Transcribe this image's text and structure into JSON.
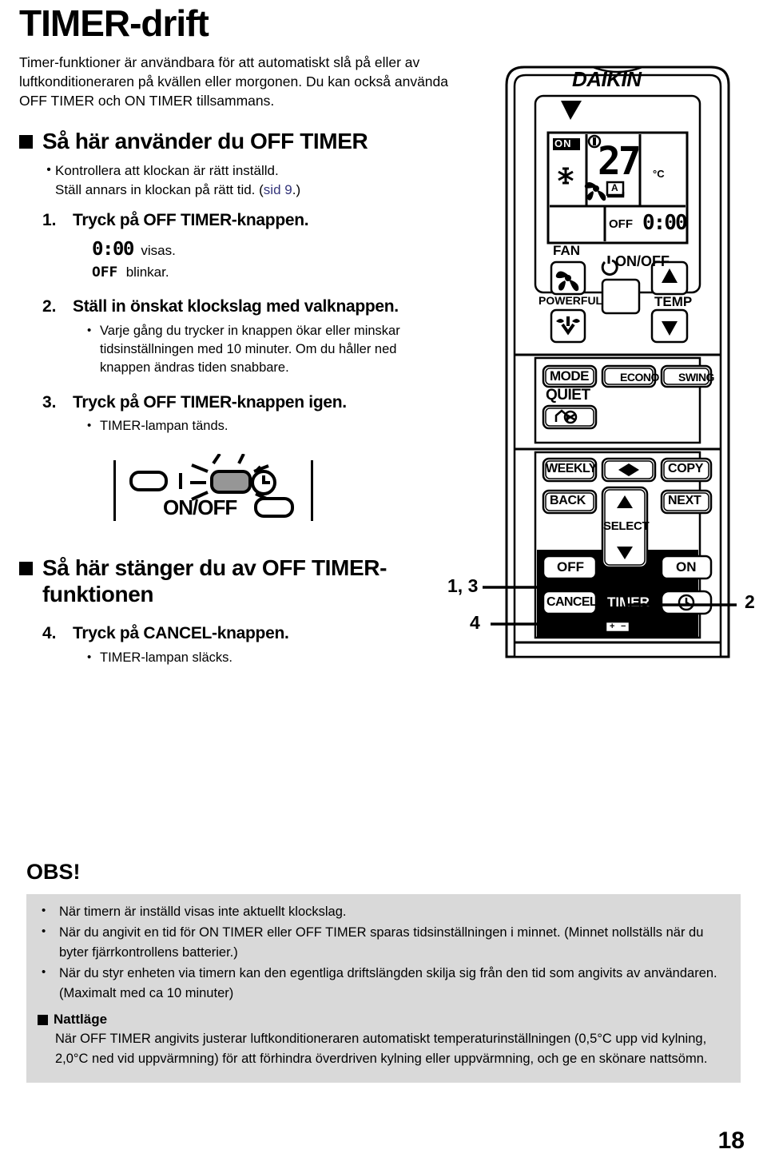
{
  "page": {
    "title": "TIMER-drift",
    "intro": "Timer-funktioner är användbara för att automatiskt slå på eller av luftkonditioneraren på kvällen eller morgonen. Du kan också använda OFF TIMER och ON TIMER tillsammans.",
    "page_number": "18"
  },
  "section_on": {
    "heading": "Så här använder du OFF TIMER",
    "note_bullet": "•",
    "note_line1": "Kontrollera att klockan är rätt inställd.",
    "note_line2_pre": "Ställ annars in klockan på rätt tid. (",
    "note_line2_link": "sid 9",
    "note_line2_post": ".)",
    "steps": [
      {
        "num": "1.",
        "title": "Tryck på OFF TIMER-knappen.",
        "lcd_time": "0:00",
        "lcd_time_label": "visas.",
        "lcd_off": "OFF",
        "lcd_off_label": "blinkar.",
        "bullets": []
      },
      {
        "num": "2.",
        "title": "Ställ in önskat klockslag med valknappen.",
        "bullets": [
          "Varje gång du trycker in knappen ökar eller minskar tidsinställningen med 10 minuter. Om du håller ned knappen ändras tiden snabbare."
        ]
      },
      {
        "num": "3.",
        "title": "Tryck på OFF TIMER-knappen igen.",
        "bullets": [
          "TIMER-lampan tänds."
        ]
      }
    ],
    "lamp_label": "ON/OFF"
  },
  "section_off": {
    "heading": "Så här stänger du av OFF TIMER-funktionen",
    "steps": [
      {
        "num": "4.",
        "title": "Tryck på CANCEL-knappen.",
        "bullets": [
          "TIMER-lampan släcks."
        ]
      }
    ]
  },
  "obs": {
    "heading": "OBS!",
    "bullet": "•",
    "items": [
      "När timern är inställd visas inte aktuellt klockslag.",
      "När du angivit en tid för ON TIMER eller OFF TIMER sparas tidsinställningen i minnet. (Minnet nollställs när du byter fjärrkontrollens batterier.)",
      "När du styr enheten via timern kan den egentliga driftslängden skilja sig från den tid som angivits av användaren. (Maximalt med ca 10 minuter)"
    ],
    "night": {
      "title": "Nattläge",
      "body": "När OFF TIMER angivits justerar luftkonditioneraren automatiskt temperaturinställningen (0,5°C upp vid kylning, 2,0°C ned vid uppvärmning) för att förhindra överdriven kylning eller uppvärmning, och ge en skönare nattsömn."
    }
  },
  "remote": {
    "brand": "DAIKIN",
    "lcd": {
      "on_badge": "ON",
      "mode_icon": "snowflake-icon",
      "temp_value": "27",
      "temp_unit": "°C",
      "fan_icon": "fan-icon",
      "fan_auto": "A",
      "timer_off_label": "OFF",
      "timer_time": "0:00"
    },
    "buttons": {
      "fan_label": "FAN",
      "powerful_label": "POWERFUL",
      "onoff_label": "ON/OFF",
      "temp_label": "TEMP",
      "temp_up": "▲",
      "temp_down": "▼",
      "mode": "MODE",
      "econo": "ECONO",
      "swing": "SWING",
      "quiet_label": "QUIET",
      "weekly": "WEEKLY",
      "copy": "COPY",
      "back": "BACK",
      "next": "NEXT",
      "select_label": "SELECT",
      "select_up": "▲",
      "select_down": "▼",
      "off": "OFF",
      "on": "ON",
      "cancel": "CANCEL",
      "timer_label": "TIMER",
      "battery_plus": "+",
      "battery_minus": "−"
    }
  },
  "callouts": {
    "a": "1, 3",
    "b": "4",
    "c": "2"
  },
  "colors": {
    "link": "#33347a",
    "note_bg": "#d9d9d9",
    "ink": "#000000",
    "lamp_fill": "#969696"
  }
}
